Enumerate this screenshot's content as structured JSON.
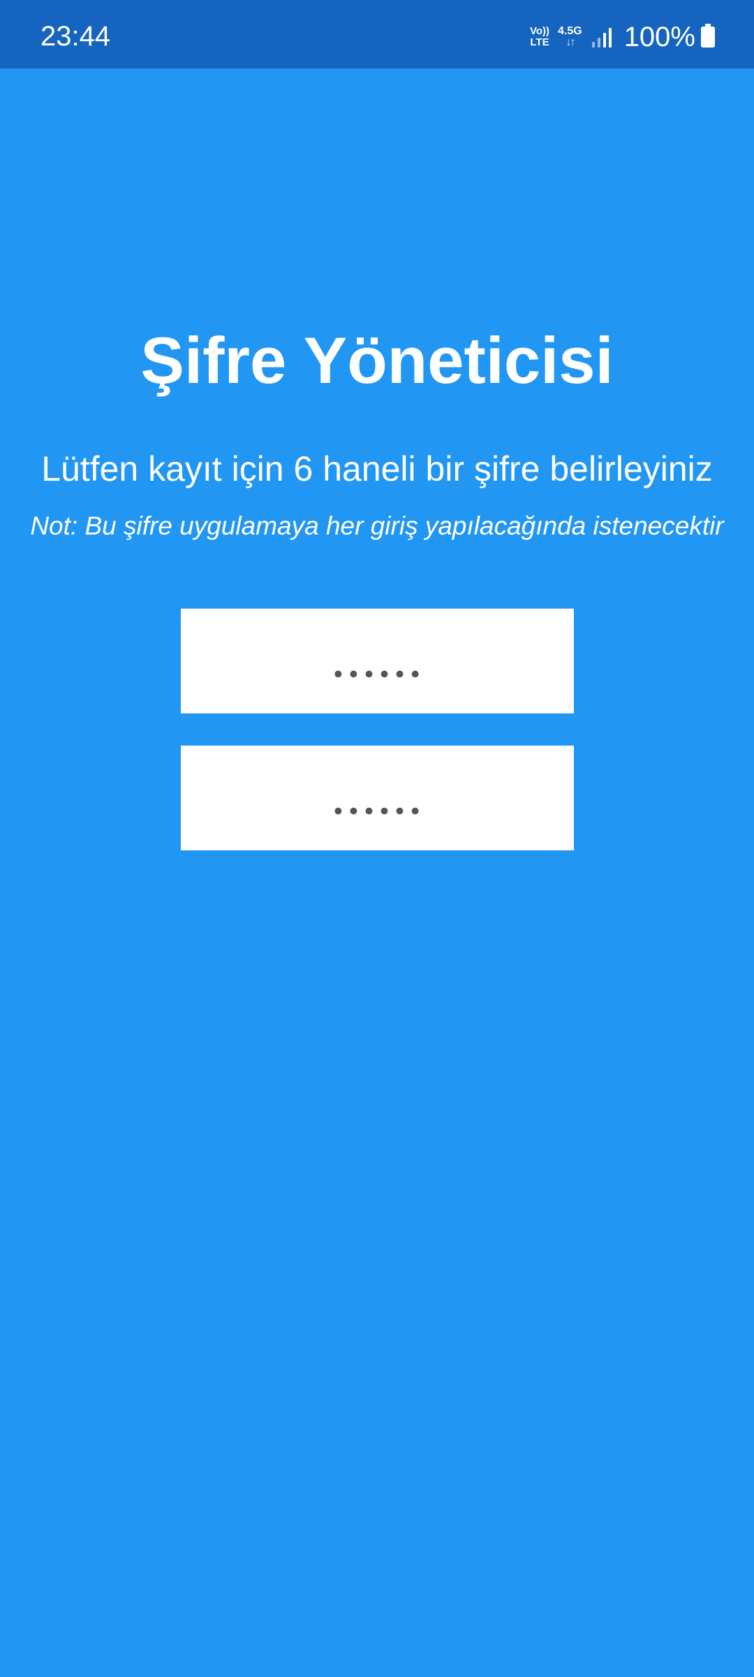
{
  "status_bar": {
    "time": "23:44",
    "volte_top": "Vo))",
    "volte_bottom": "LTE",
    "network": "4.5G",
    "network_arrows": "↓↑",
    "battery_percent": "100%",
    "icons": [
      "volte-icon",
      "network-4-5g-icon",
      "signal-icon",
      "battery-icon"
    ]
  },
  "header": {
    "title": "Şifre Yöneticisi",
    "subtitle": "Lütfen kayıt için 6 haneli bir şifre belirleyiniz",
    "note": "Not: Bu şifre uygulamaya her giriş yapılacağında istenecektir"
  },
  "form": {
    "password_field_1_value": "••••••",
    "password_field_2_value": "••••••"
  },
  "colors": {
    "background": "#2196F3",
    "status_bar": "#1565C0",
    "field_background": "#FFFFFF",
    "text": "#FFFFFF"
  }
}
